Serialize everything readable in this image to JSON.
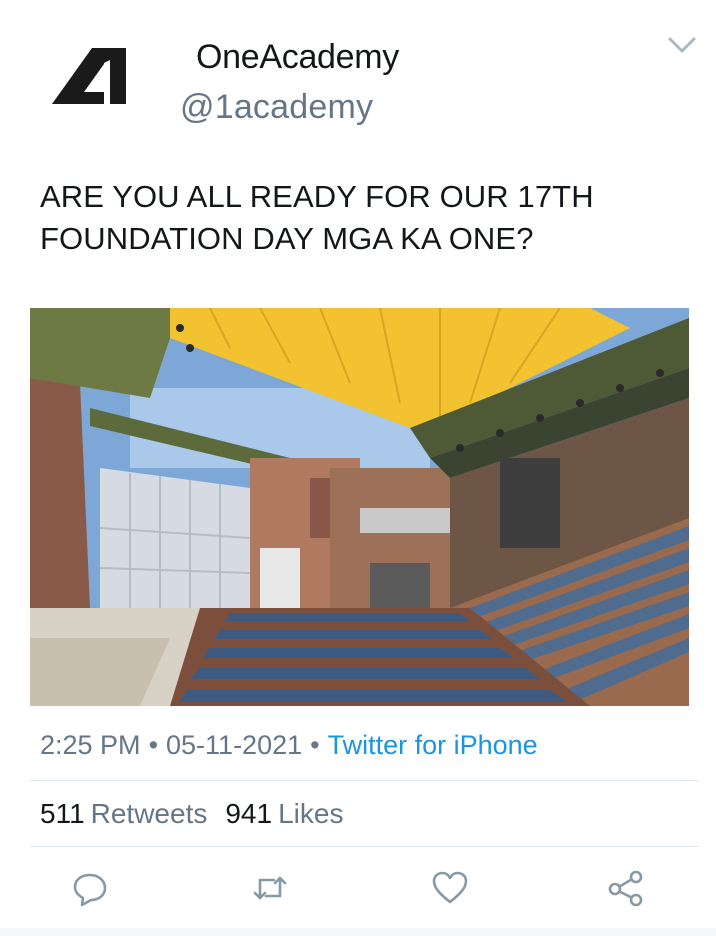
{
  "account": {
    "display_name": "OneAcademy",
    "handle": "@1academy",
    "logo_icon": "one-academy-logo-icon"
  },
  "tweet": {
    "lines": [
      "ARE YOU ALL READY FOR OUR 17TH",
      "FOUNDATION DAY MGA KA ONE?"
    ],
    "media_icon": "stadium-photo"
  },
  "meta": {
    "time": "2:25 PM",
    "separator": "•",
    "date": "05-11-2021",
    "source": "Twitter for iPhone"
  },
  "stats": {
    "retweets_count": "511",
    "retweets_label": "Retweets",
    "likes_count": "941",
    "likes_label": "Likes"
  },
  "actions": {
    "reply_icon": "reply-icon",
    "retweet_icon": "retweet-icon",
    "like_icon": "heart-icon",
    "share_icon": "share-icon"
  },
  "colors": {
    "text": "#14171a",
    "muted": "#657786",
    "link": "#1b95e0",
    "divider": "#e1e8ed",
    "awning_yellow": "#f2c230"
  }
}
